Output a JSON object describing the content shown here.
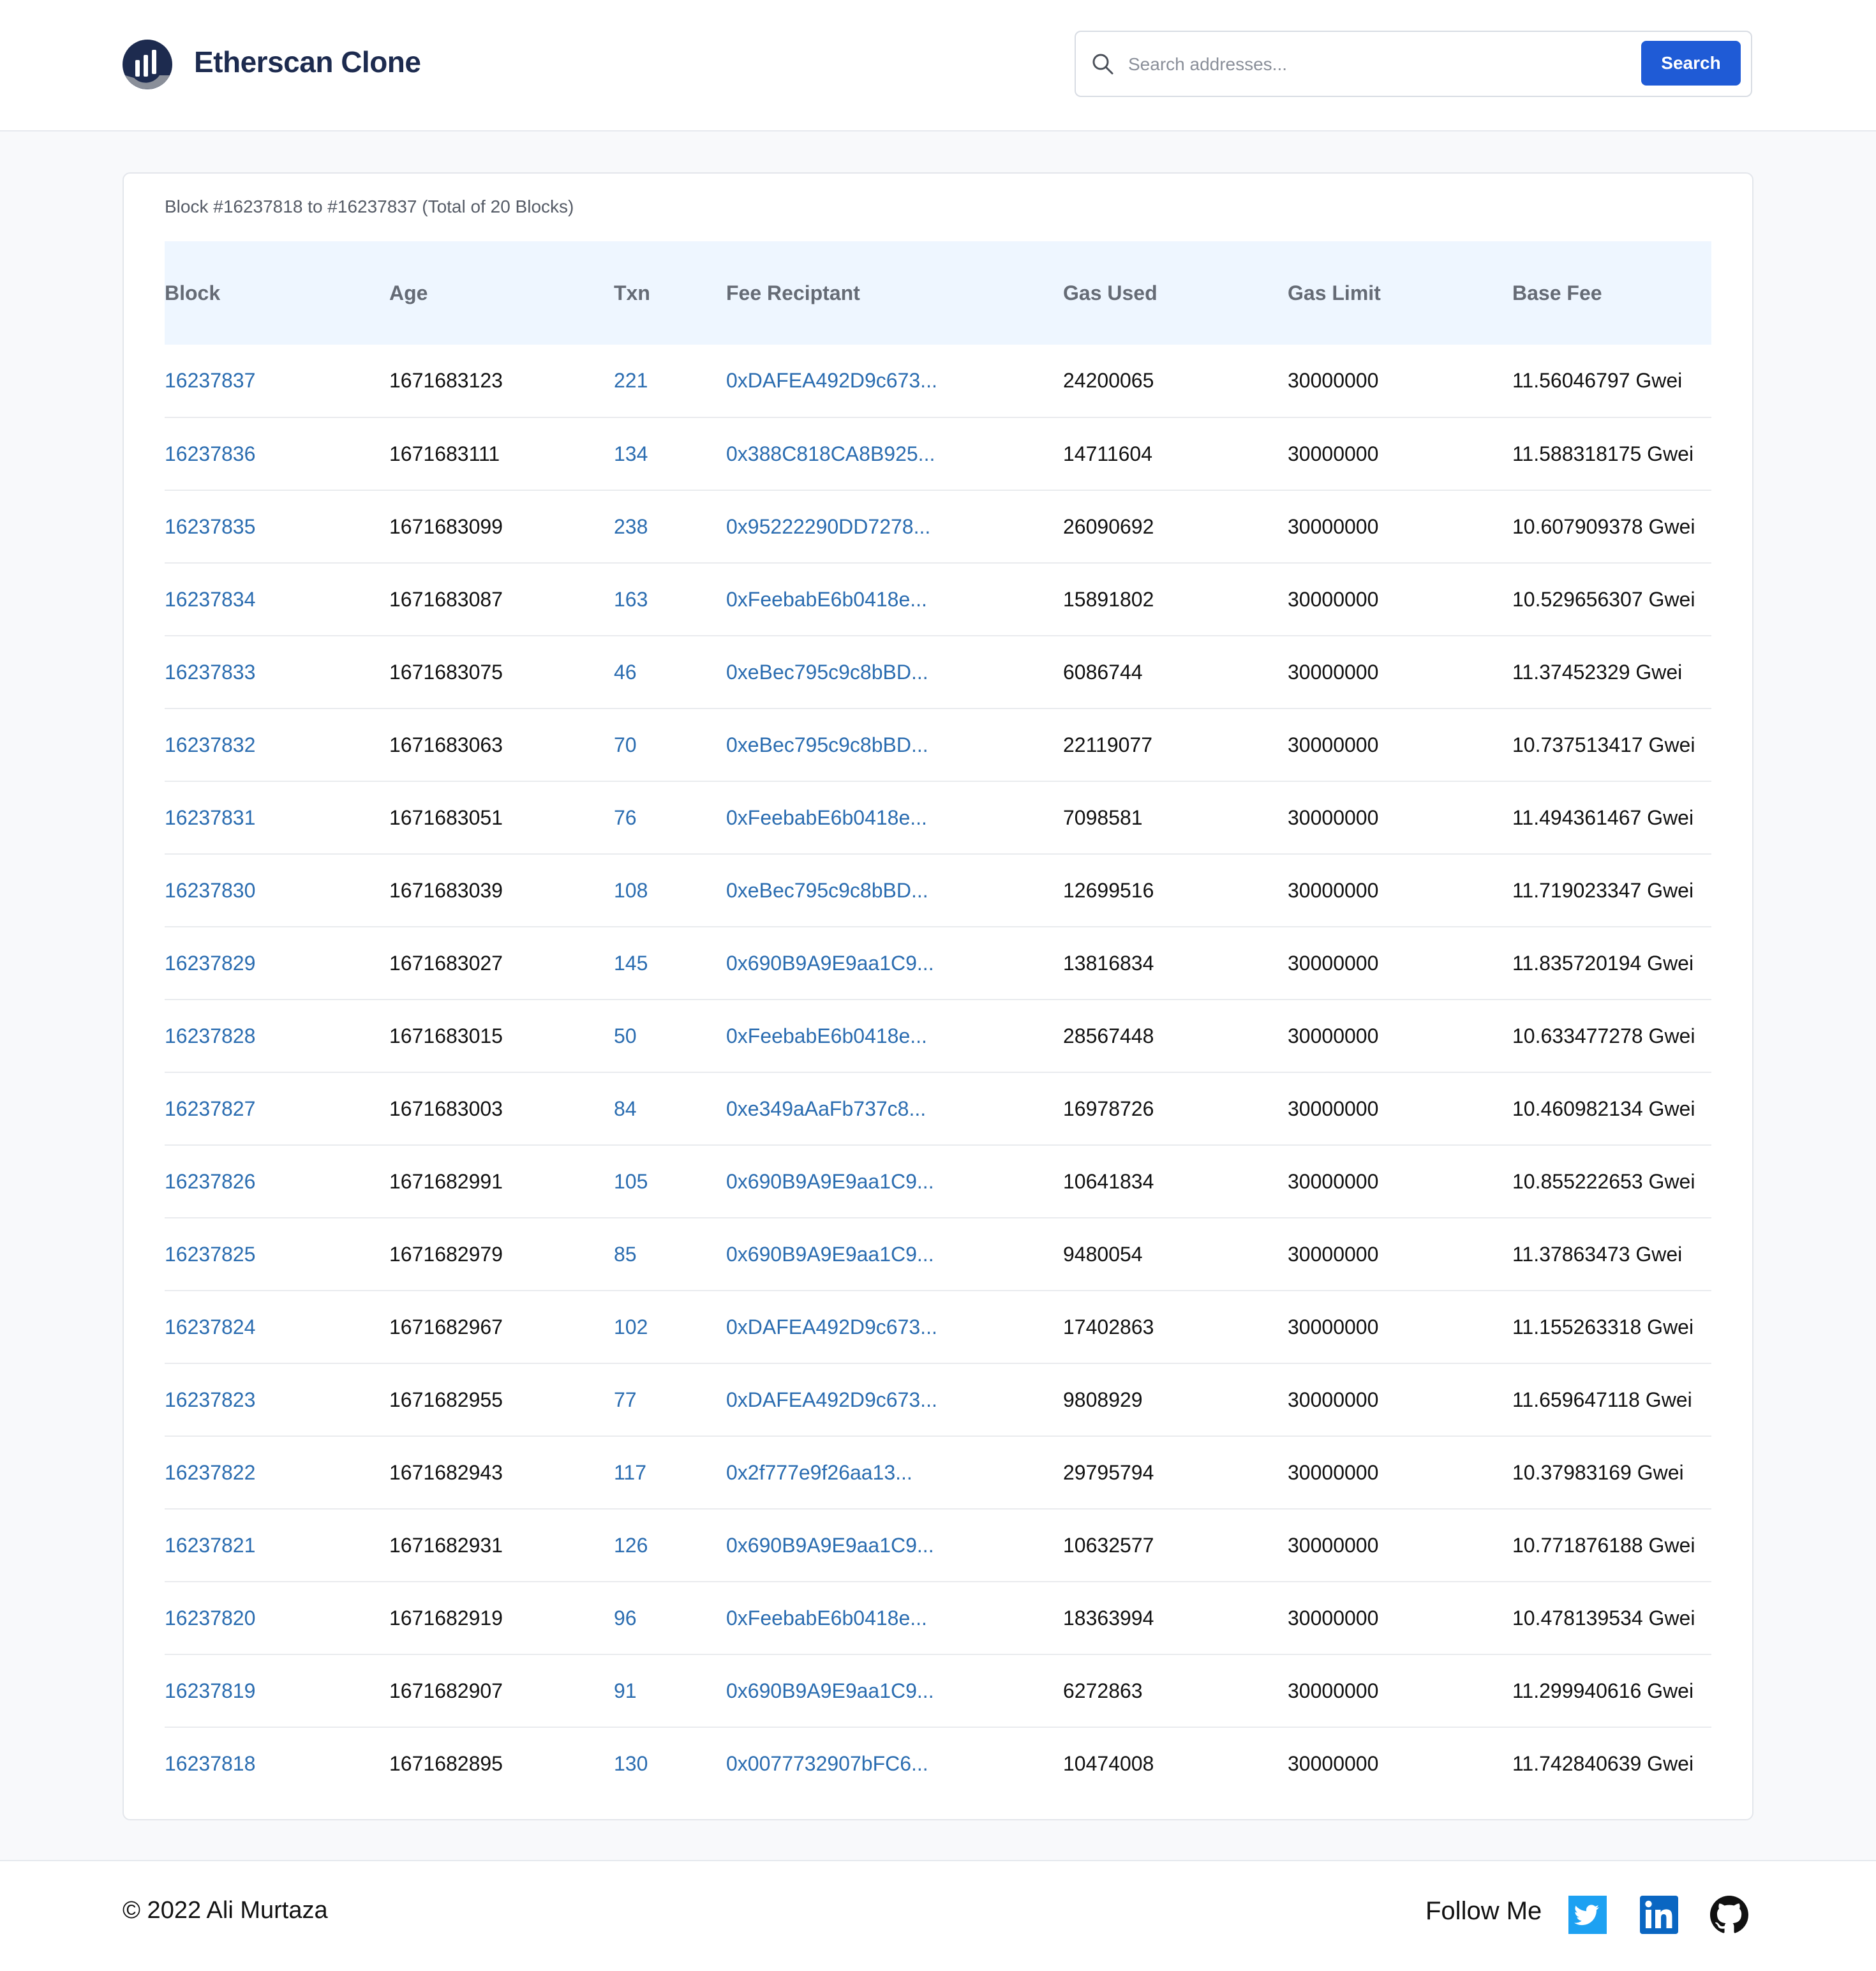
{
  "header": {
    "brand": "Etherscan Clone",
    "search_placeholder": "Search addresses...",
    "search_button": "Search"
  },
  "summary": "Block #16237818 to #16237837 (Total of 20 Blocks)",
  "table": {
    "columns": [
      "Block",
      "Age",
      "Txn",
      "Fee Reciptant",
      "Gas Used",
      "Gas Limit",
      "Base Fee"
    ],
    "rows": [
      [
        "16237837",
        "1671683123",
        "221",
        "0xDAFEA492D9c673...",
        "24200065",
        "30000000",
        "11.56046797 Gwei"
      ],
      [
        "16237836",
        "1671683111",
        "134",
        "0x388C818CA8B925...",
        "14711604",
        "30000000",
        "11.588318175 Gwei"
      ],
      [
        "16237835",
        "1671683099",
        "238",
        "0x95222290DD7278...",
        "26090692",
        "30000000",
        "10.607909378 Gwei"
      ],
      [
        "16237834",
        "1671683087",
        "163",
        "0xFeebabE6b0418e...",
        "15891802",
        "30000000",
        "10.529656307 Gwei"
      ],
      [
        "16237833",
        "1671683075",
        "46",
        "0xeBec795c9c8bBD...",
        "6086744",
        "30000000",
        "11.37452329 Gwei"
      ],
      [
        "16237832",
        "1671683063",
        "70",
        "0xeBec795c9c8bBD...",
        "22119077",
        "30000000",
        "10.737513417 Gwei"
      ],
      [
        "16237831",
        "1671683051",
        "76",
        "0xFeebabE6b0418e...",
        "7098581",
        "30000000",
        "11.494361467 Gwei"
      ],
      [
        "16237830",
        "1671683039",
        "108",
        "0xeBec795c9c8bBD...",
        "12699516",
        "30000000",
        "11.719023347 Gwei"
      ],
      [
        "16237829",
        "1671683027",
        "145",
        "0x690B9A9E9aa1C9...",
        "13816834",
        "30000000",
        "11.835720194 Gwei"
      ],
      [
        "16237828",
        "1671683015",
        "50",
        "0xFeebabE6b0418e...",
        "28567448",
        "30000000",
        "10.633477278 Gwei"
      ],
      [
        "16237827",
        "1671683003",
        "84",
        "0xe349aAaFb737c8...",
        "16978726",
        "30000000",
        "10.460982134 Gwei"
      ],
      [
        "16237826",
        "1671682991",
        "105",
        "0x690B9A9E9aa1C9...",
        "10641834",
        "30000000",
        "10.855222653 Gwei"
      ],
      [
        "16237825",
        "1671682979",
        "85",
        "0x690B9A9E9aa1C9...",
        "9480054",
        "30000000",
        "11.37863473 Gwei"
      ],
      [
        "16237824",
        "1671682967",
        "102",
        "0xDAFEA492D9c673...",
        "17402863",
        "30000000",
        "11.155263318 Gwei"
      ],
      [
        "16237823",
        "1671682955",
        "77",
        "0xDAFEA492D9c673...",
        "9808929",
        "30000000",
        "11.659647118 Gwei"
      ],
      [
        "16237822",
        "1671682943",
        "117",
        "0x2f777e9f26aa13...",
        "29795794",
        "30000000",
        "10.37983169 Gwei"
      ],
      [
        "16237821",
        "1671682931",
        "126",
        "0x690B9A9E9aa1C9...",
        "10632577",
        "30000000",
        "10.771876188 Gwei"
      ],
      [
        "16237820",
        "1671682919",
        "96",
        "0xFeebabE6b0418e...",
        "18363994",
        "30000000",
        "10.478139534 Gwei"
      ],
      [
        "16237819",
        "1671682907",
        "91",
        "0x690B9A9E9aa1C9...",
        "6272863",
        "30000000",
        "11.299940616 Gwei"
      ],
      [
        "16237818",
        "1671682895",
        "130",
        "0x0077732907bFC6...",
        "10474008",
        "30000000",
        "11.742840639 Gwei"
      ]
    ]
  },
  "footer": {
    "copyright": "© 2022 Ali Murtaza",
    "follow": "Follow Me",
    "social_icons": [
      "twitter-icon",
      "linkedin-icon",
      "github-icon"
    ]
  },
  "colors": {
    "accent": "#1f5bd6",
    "link": "#2a6cb0",
    "brand_text": "#1d2b4f",
    "header_row_bg": "#eef6ff",
    "twitter": "#1da1f2",
    "linkedin": "#0a66c2"
  }
}
